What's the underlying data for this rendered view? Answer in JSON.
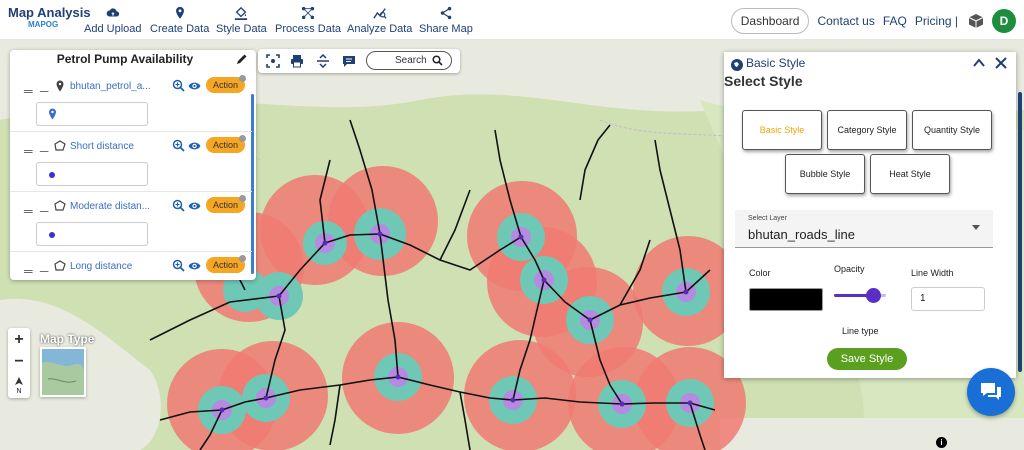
{
  "brand": {
    "title": "Map Analysis",
    "subtitle": "MAPOG"
  },
  "nav": [
    {
      "label": "Add Upload",
      "icon": "cloud-upload-icon"
    },
    {
      "label": "Create Data",
      "icon": "location-pin-icon"
    },
    {
      "label": "Style Data",
      "icon": "paint-bucket-icon"
    },
    {
      "label": "Process Data",
      "icon": "process-nodes-icon"
    },
    {
      "label": "Analyze Data",
      "icon": "analyze-chart-icon"
    },
    {
      "label": "Share Map",
      "icon": "share-icon"
    }
  ],
  "top_right": {
    "dashboard": "Dashboard",
    "contact": "Contact us",
    "faq": "FAQ",
    "pricing": "Pricing |",
    "avatar_letter": "D"
  },
  "layer_panel": {
    "title": "Petrol Pump Availability",
    "action_label": "Action",
    "layers": [
      {
        "name": "bhutan_petrol_a...",
        "type": "point",
        "icon": "location-pin-icon"
      },
      {
        "name": "Short distance",
        "type": "polygon",
        "icon": "polygon-icon"
      },
      {
        "name": "Moderate distan...",
        "type": "polygon",
        "icon": "polygon-icon"
      },
      {
        "name": "Long distance",
        "type": "polygon",
        "icon": "polygon-icon"
      }
    ]
  },
  "map_toolbar": {
    "search_label": "Search"
  },
  "map_controls": {
    "zoom_in": "+",
    "zoom_out": "−",
    "map_type_label": "Map Type"
  },
  "style_panel": {
    "header_title": "Basic Style",
    "title": "Select Style",
    "style_options": [
      {
        "label": "Basic Style",
        "active": true
      },
      {
        "label": "Category Style",
        "active": false
      },
      {
        "label": "Quantity Style",
        "active": false
      },
      {
        "label": "Bubble Style",
        "active": false
      },
      {
        "label": "Heat Style",
        "active": false
      }
    ],
    "select_layer_label": "Select Layer",
    "select_layer_value": "bhutan_roads_line",
    "color_label": "Color",
    "color_value": "#000000",
    "opacity_label": "Opacity",
    "opacity_value": 0.75,
    "line_width_label": "Line Width",
    "line_width_value": "1",
    "line_type_label": "Line type",
    "save_label": "Save Style"
  },
  "colors": {
    "accent_orange": "#f5a623",
    "save_green": "#5aa01e",
    "brand_blue": "#1f3f77",
    "buffer_long": "#f07a72",
    "buffer_moderate": "#6fc7b6",
    "buffer_short": "#b48be0"
  }
}
